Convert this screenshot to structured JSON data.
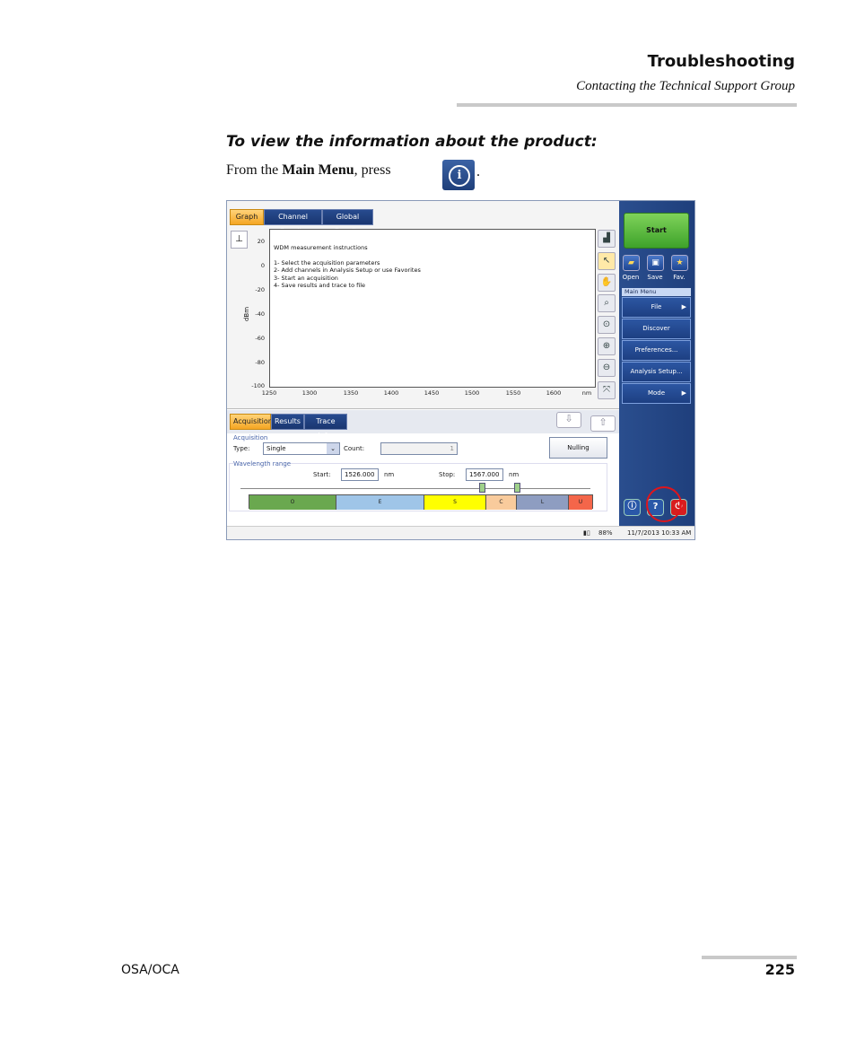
{
  "header": {
    "section_title": "Troubleshooting",
    "subtitle": "Contacting the Technical Support Group"
  },
  "step": {
    "title": "To view the information about the product:",
    "text_prefix": "From the ",
    "text_bold": "Main Menu",
    "text_suffix": ", press",
    "period": "."
  },
  "footer": {
    "product": "OSA/OCA",
    "page_number": "225"
  },
  "screenshot": {
    "top_tabs": [
      "Graph",
      "Channel Results",
      "Global Results"
    ],
    "instructions": [
      "WDM measurement instructions",
      "1- Select the acquisition parameters",
      "2- Add channels in Analysis Setup or use Favorites",
      "3- Start an acquisition",
      "4- Save results and trace to file"
    ],
    "y_axis": {
      "label": "dBm",
      "ticks": [
        "20",
        "0",
        "-20",
        "-40",
        "-60",
        "-80",
        "-100"
      ]
    },
    "x_axis": {
      "ticks": [
        "1250",
        "1300",
        "1350",
        "1400",
        "1450",
        "1500",
        "1550",
        "1600"
      ],
      "unit": "nm"
    },
    "start_button": "Start",
    "quick_buttons": [
      "Open",
      "Save",
      "Fav."
    ],
    "main_menu": {
      "title": "Main Menu",
      "items": [
        {
          "label": "File",
          "arrow": "▶"
        },
        {
          "label": "Discover",
          "arrow": ""
        },
        {
          "label": "Preferences...",
          "arrow": ""
        },
        {
          "label": "Analysis Setup...",
          "arrow": ""
        },
        {
          "label": "Mode",
          "arrow": "▶"
        }
      ]
    },
    "bottom_tabs": [
      "Acquisition",
      "Results",
      "Trace Info."
    ],
    "acquisition": {
      "group_label": "Acquisition",
      "type_label": "Type:",
      "type_value": "Single",
      "count_label": "Count:",
      "count_value": "1",
      "nulling_button": "Nulling"
    },
    "wavelength": {
      "group_label": "Wavelength range",
      "start_label": "Start:",
      "start_value": "1526.000",
      "start_unit": "nm",
      "stop_label": "Stop:",
      "stop_value": "1567.000",
      "stop_unit": "nm",
      "bands": [
        {
          "name": "O",
          "color": "#6aa84f"
        },
        {
          "name": "E",
          "color": "#9fc5e8"
        },
        {
          "name": "S",
          "color": "#ffff00"
        },
        {
          "name": "C",
          "color": "#f9cb9c"
        },
        {
          "name": "L",
          "color": "#8e9dc1"
        },
        {
          "name": "U",
          "color": "#f4664a"
        }
      ]
    },
    "status": {
      "battery": "88%",
      "datetime": "11/7/2013 10:33 AM"
    }
  }
}
